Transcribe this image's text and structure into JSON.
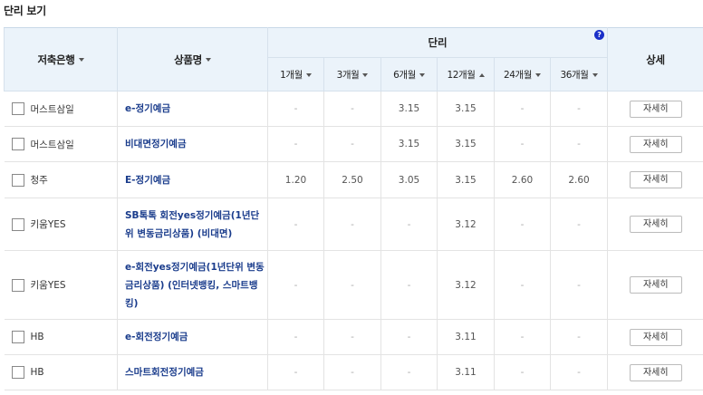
{
  "section_title": "단리 보기",
  "header": {
    "bank": "저축은행",
    "product": "상품명",
    "rate": "단리",
    "detail": "상세",
    "help": "?",
    "terms": [
      "1개월",
      "3개월",
      "6개월",
      "12개월",
      "24개월",
      "36개월"
    ],
    "active_sort_term": "12개월"
  },
  "detail_label": "자세히",
  "rows": [
    {
      "bank": "머스트삼일",
      "product": "e-정기예금",
      "rates": [
        "-",
        "-",
        "3.15",
        "3.15",
        "-",
        "-"
      ]
    },
    {
      "bank": "머스트삼일",
      "product": "비대면정기예금",
      "rates": [
        "-",
        "-",
        "3.15",
        "3.15",
        "-",
        "-"
      ]
    },
    {
      "bank": "청주",
      "product": "E-정기예금",
      "rates": [
        "1.20",
        "2.50",
        "3.05",
        "3.15",
        "2.60",
        "2.60"
      ]
    },
    {
      "bank": "키움YES",
      "product": "SB톡톡 회전yes정기예금(1년단위 변동금리상품) (비대면)",
      "rates": [
        "-",
        "-",
        "-",
        "3.12",
        "-",
        "-"
      ]
    },
    {
      "bank": "키움YES",
      "product": "e-회전yes정기예금(1년단위 변동금리상품) (인터넷뱅킹, 스마트뱅킹)",
      "rates": [
        "-",
        "-",
        "-",
        "3.12",
        "-",
        "-"
      ]
    },
    {
      "bank": "HB",
      "product": "e-회전정기예금",
      "rates": [
        "-",
        "-",
        "-",
        "3.11",
        "-",
        "-"
      ]
    },
    {
      "bank": "HB",
      "product": "스마트회전정기예금",
      "rates": [
        "-",
        "-",
        "-",
        "3.11",
        "-",
        "-"
      ]
    }
  ]
}
